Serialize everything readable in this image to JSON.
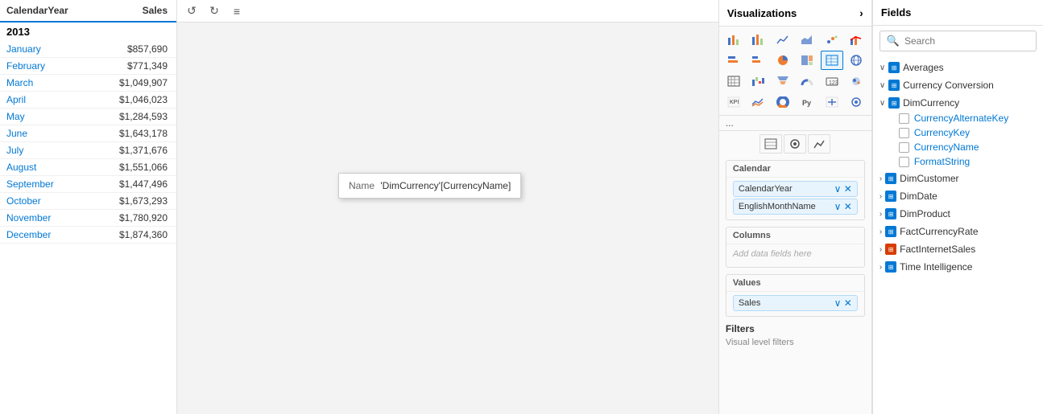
{
  "table": {
    "headers": [
      "CalendarYear",
      "Sales"
    ],
    "year_2013": "2013",
    "rows": [
      {
        "month": "January",
        "value": "$857,690"
      },
      {
        "month": "February",
        "value": "$771,349"
      },
      {
        "month": "March",
        "value": "$1,049,907"
      },
      {
        "month": "April",
        "value": "$1,046,023"
      },
      {
        "month": "May",
        "value": "$1,284,593"
      },
      {
        "month": "June",
        "value": "$1,643,178"
      },
      {
        "month": "July",
        "value": "$1,371,676"
      },
      {
        "month": "August",
        "value": "$1,551,066"
      },
      {
        "month": "September",
        "value": "$1,447,496"
      },
      {
        "month": "October",
        "value": "$1,673,293"
      },
      {
        "month": "November",
        "value": "$1,780,920"
      },
      {
        "month": "December",
        "value": "$1,874,360"
      }
    ]
  },
  "tooltip": {
    "label": "Name",
    "value": "'DimCurrency'[CurrencyName]"
  },
  "visualizations": {
    "header": "Visualizations",
    "icons": [
      "📊",
      "📈",
      "📉",
      "📋",
      "🔢",
      "⬜",
      "📄",
      "🔵",
      "🥧",
      "📐",
      "⊞",
      "🌐",
      "⬛",
      "〰",
      "📊",
      "📋",
      "◻",
      "🌐",
      "📋",
      "〰",
      "🔘",
      "📝",
      "🔤",
      "🌐"
    ],
    "more": "...",
    "field_tabs": [
      "⊞",
      "🖌",
      "⚙"
    ],
    "rows_section": {
      "label": "Calendar",
      "chips": [
        "CalendarYear",
        "EnglishMonthName"
      ]
    },
    "columns_section": {
      "label": "Columns",
      "placeholder": "Add data fields here"
    },
    "values_section": {
      "label": "Values",
      "chips": [
        "Sales"
      ]
    },
    "filters": {
      "header": "Filters",
      "sub": "Visual level filters"
    }
  },
  "fields": {
    "header": "Fields",
    "search_placeholder": "Search",
    "groups": [
      {
        "name": "Averages",
        "icon_type": "blue",
        "expanded": true,
        "items": []
      },
      {
        "name": "Currency Conversion",
        "icon_type": "blue",
        "expanded": true,
        "items": []
      },
      {
        "name": "DimCurrency",
        "icon_type": "blue",
        "expanded": true,
        "items": [
          {
            "name": "CurrencyAlternateKey",
            "checked": false
          },
          {
            "name": "CurrencyKey",
            "checked": false
          },
          {
            "name": "CurrencyName",
            "checked": false
          },
          {
            "name": "FormatString",
            "checked": false
          }
        ]
      },
      {
        "name": "DimCustomer",
        "icon_type": "blue",
        "expanded": false,
        "items": []
      },
      {
        "name": "DimDate",
        "icon_type": "blue",
        "expanded": false,
        "items": []
      },
      {
        "name": "DimProduct",
        "icon_type": "blue",
        "expanded": false,
        "items": []
      },
      {
        "name": "FactCurrencyRate",
        "icon_type": "blue",
        "expanded": false,
        "items": []
      },
      {
        "name": "FactInternetSales",
        "icon_type": "orange",
        "expanded": false,
        "items": []
      },
      {
        "name": "Time Intelligence",
        "icon_type": "blue",
        "expanded": false,
        "items": []
      }
    ]
  }
}
